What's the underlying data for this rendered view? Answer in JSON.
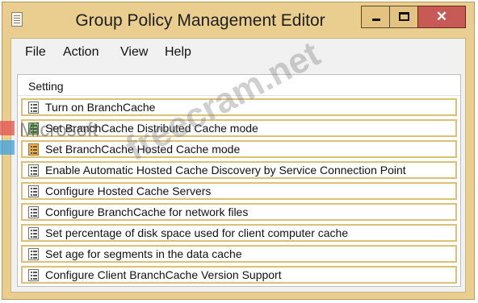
{
  "window": {
    "title": "Group Policy Management Editor",
    "controls": {
      "minimize": "minimize",
      "maximize": "maximize",
      "close": "✕"
    }
  },
  "menu": {
    "items": [
      "File",
      "Action",
      "View",
      "Help"
    ]
  },
  "list": {
    "header": "Setting",
    "rows": [
      {
        "label": "Turn on BranchCache",
        "icon": "policy-setting-icon"
      },
      {
        "label": "Set BranchCache Distributed Cache mode",
        "icon": "policy-setting-icon"
      },
      {
        "label": "Set BranchCache Hosted Cache mode",
        "icon": "policy-setting-icon"
      },
      {
        "label": "Enable Automatic Hosted Cache Discovery by Service Connection Point",
        "icon": "policy-setting-icon"
      },
      {
        "label": "Configure Hosted Cache Servers",
        "icon": "policy-setting-icon"
      },
      {
        "label": "Configure BranchCache for network files",
        "icon": "policy-setting-icon"
      },
      {
        "label": "Set percentage of disk space used for client computer cache",
        "icon": "policy-setting-icon"
      },
      {
        "label": "Set age for segments in the data cache",
        "icon": "policy-setting-icon"
      },
      {
        "label": "Configure Client BranchCache Version Support",
        "icon": "policy-setting-icon"
      }
    ]
  },
  "watermarks": {
    "brand": "Microsoft",
    "site": "freecram.net"
  },
  "colors": {
    "window_frame": "#e9ce90",
    "row_border": "#dcc07a",
    "close_button": "#c85a55"
  }
}
